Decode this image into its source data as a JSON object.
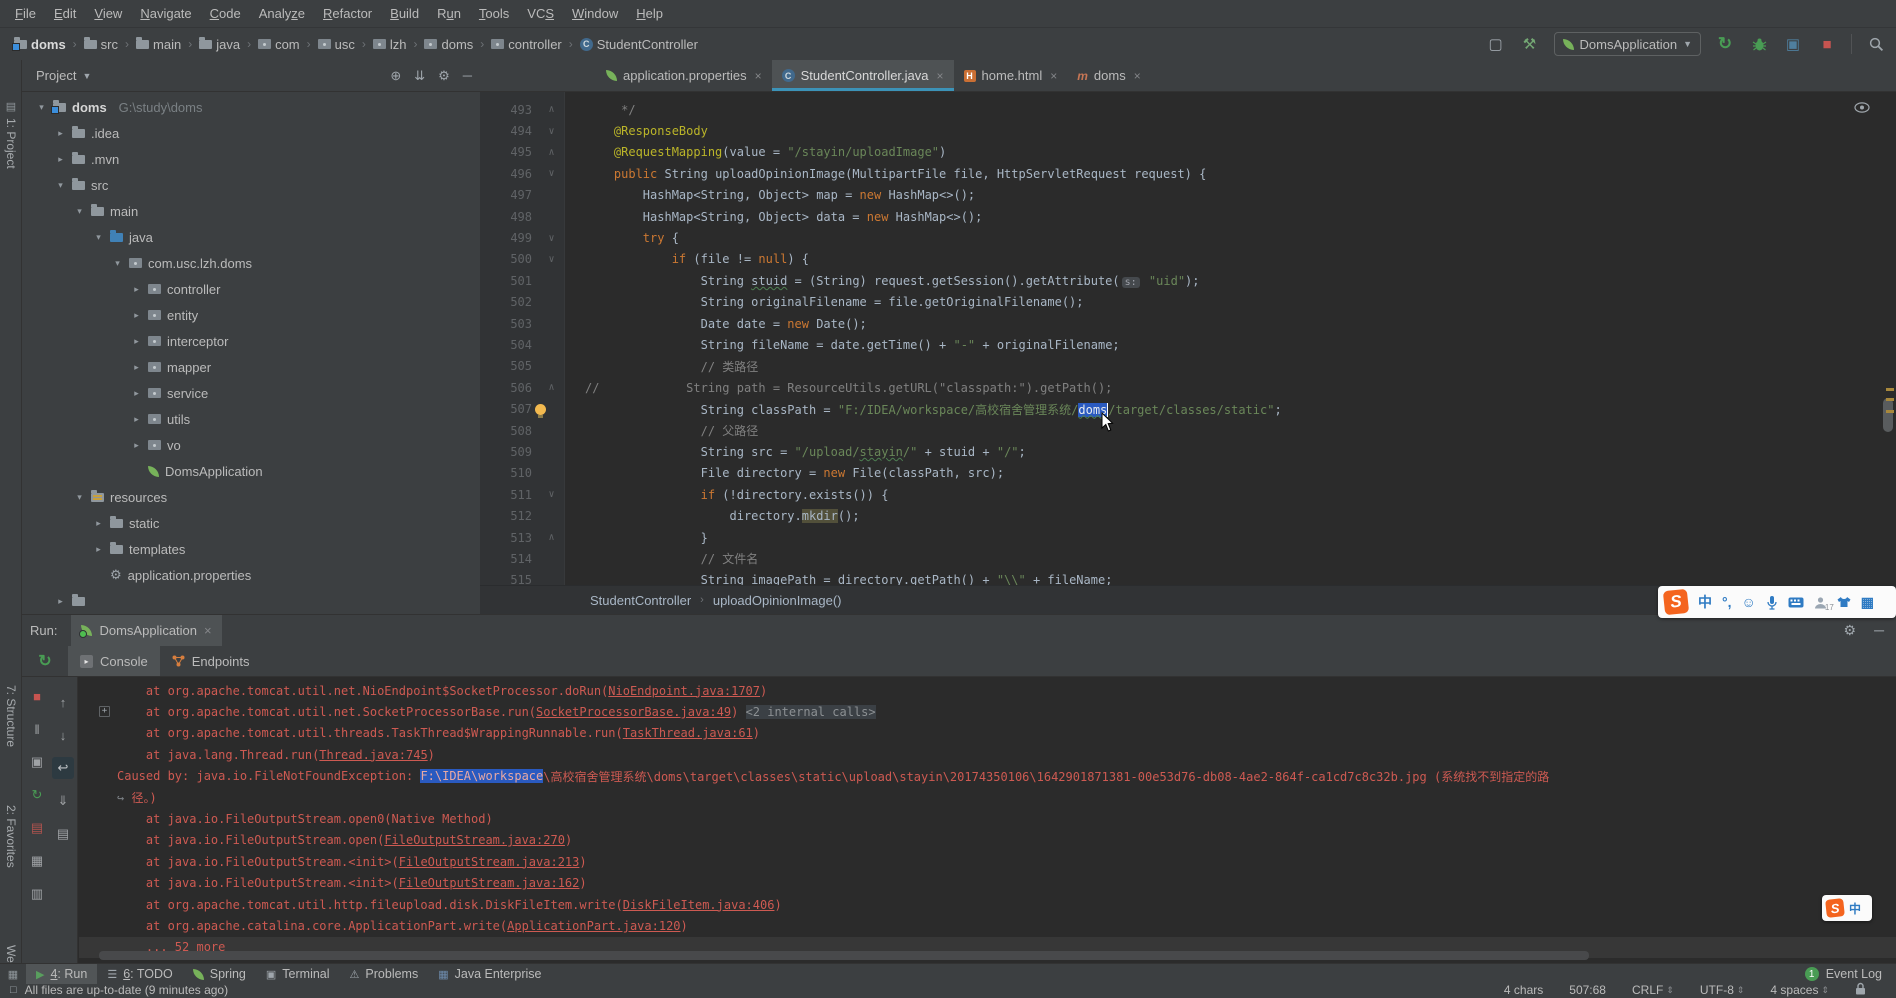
{
  "colors": {
    "chrome": "#3C3F41",
    "editor_bg": "#2B2B2B",
    "accent_blue": "#3C93B8",
    "selection": "#2A5AC0",
    "error_red": "#CE5A52",
    "string_green": "#6A8759",
    "keyword_orange": "#CC7832",
    "comment_gray": "#808080",
    "annotation_yellow": "#BBB529",
    "run_green": "#499C54",
    "stop_red": "#C75450"
  },
  "menu": {
    "items": [
      {
        "label": "File",
        "u": 0
      },
      {
        "label": "Edit",
        "u": 0
      },
      {
        "label": "View",
        "u": 0
      },
      {
        "label": "Navigate",
        "u": 0
      },
      {
        "label": "Code",
        "u": 0
      },
      {
        "label": "Analyze",
        "u": 5
      },
      {
        "label": "Refactor",
        "u": 0
      },
      {
        "label": "Build",
        "u": 0
      },
      {
        "label": "Run",
        "u": 1
      },
      {
        "label": "Tools",
        "u": 0
      },
      {
        "label": "VCS",
        "u": 2
      },
      {
        "label": "Window",
        "u": 0
      },
      {
        "label": "Help",
        "u": 0
      }
    ]
  },
  "toolbar": {
    "breadcrumbs": [
      {
        "label": "doms",
        "icon": "project",
        "bold": true
      },
      {
        "label": "src",
        "icon": "folder"
      },
      {
        "label": "main",
        "icon": "folder"
      },
      {
        "label": "java",
        "icon": "folder"
      },
      {
        "label": "com",
        "icon": "package"
      },
      {
        "label": "usc",
        "icon": "package"
      },
      {
        "label": "lzh",
        "icon": "package"
      },
      {
        "label": "doms",
        "icon": "package"
      },
      {
        "label": "controller",
        "icon": "package"
      },
      {
        "label": "StudentController",
        "icon": "class"
      }
    ],
    "run_config": "DomsApplication"
  },
  "stripe_labels": [
    "1: Project",
    "7: Structure",
    "2: Favorites",
    "Web"
  ],
  "project_panel": {
    "title": "Project",
    "tree": [
      {
        "d": 0,
        "ch": "open",
        "icon": "project",
        "label": "doms",
        "extra": "G:\\study\\doms",
        "bold": true
      },
      {
        "d": 1,
        "ch": "closed",
        "icon": "folder",
        "label": ".idea"
      },
      {
        "d": 1,
        "ch": "closed",
        "icon": "folder",
        "label": ".mvn"
      },
      {
        "d": 1,
        "ch": "open",
        "icon": "folder",
        "label": "src"
      },
      {
        "d": 2,
        "ch": "open",
        "icon": "folder",
        "label": "main"
      },
      {
        "d": 3,
        "ch": "open",
        "icon": "folder-java",
        "label": "java"
      },
      {
        "d": 4,
        "ch": "open",
        "icon": "package",
        "label": "com.usc.lzh.doms"
      },
      {
        "d": 5,
        "ch": "closed",
        "icon": "package",
        "label": "controller"
      },
      {
        "d": 5,
        "ch": "closed",
        "icon": "package",
        "label": "entity"
      },
      {
        "d": 5,
        "ch": "closed",
        "icon": "package",
        "label": "interceptor"
      },
      {
        "d": 5,
        "ch": "closed",
        "icon": "package",
        "label": "mapper"
      },
      {
        "d": 5,
        "ch": "closed",
        "icon": "package",
        "label": "service"
      },
      {
        "d": 5,
        "ch": "closed",
        "icon": "package",
        "label": "utils"
      },
      {
        "d": 5,
        "ch": "closed",
        "icon": "package",
        "label": "vo"
      },
      {
        "d": 5,
        "ch": "none",
        "icon": "spring",
        "label": "DomsApplication"
      },
      {
        "d": 2,
        "ch": "open",
        "icon": "folder-res",
        "label": "resources"
      },
      {
        "d": 3,
        "ch": "closed",
        "icon": "folder",
        "label": "static"
      },
      {
        "d": 3,
        "ch": "closed",
        "icon": "folder",
        "label": "templates"
      },
      {
        "d": 3,
        "ch": "none",
        "icon": "props",
        "label": "application.properties"
      },
      {
        "d": 1,
        "ch": "closed",
        "icon": "folder",
        "label": ""
      }
    ]
  },
  "editor": {
    "tabs": [
      {
        "label": "application.properties",
        "icon": "spring",
        "selected": false
      },
      {
        "label": "StudentController.java",
        "icon": "class",
        "selected": true
      },
      {
        "label": "home.html",
        "icon": "html",
        "selected": false
      },
      {
        "label": "doms",
        "icon": "maven",
        "selected": false
      }
    ],
    "breadcrumb_class": "StudentController",
    "breadcrumb_method": "uploadOpinionImage()",
    "lines": [
      {
        "n": 493,
        "f": "e",
        "seg": [
          [
            "     */",
            "c"
          ]
        ]
      },
      {
        "n": 494,
        "f": "s",
        "seg": [
          [
            "    ",
            "p"
          ],
          [
            "@ResponseBody",
            "a"
          ]
        ]
      },
      {
        "n": 495,
        "f": "e",
        "seg": [
          [
            "    ",
            "p"
          ],
          [
            "@RequestMapping",
            "a"
          ],
          [
            "(value = ",
            "p"
          ],
          [
            "\"/stayin/uploadImage\"",
            "s"
          ],
          [
            ")",
            "p"
          ]
        ]
      },
      {
        "n": 496,
        "f": "s",
        "seg": [
          [
            "    ",
            "p"
          ],
          [
            "public",
            "k"
          ],
          [
            " String uploadOpinionImage(MultipartFile file, HttpServletRequest request) {",
            "p"
          ]
        ]
      },
      {
        "n": 497,
        "f": "",
        "seg": [
          [
            "        HashMap<String, Object> map = ",
            "p"
          ],
          [
            "new",
            "k"
          ],
          [
            " HashMap<>();",
            "p"
          ]
        ]
      },
      {
        "n": 498,
        "f": "",
        "seg": [
          [
            "        HashMap<String, Object> data = ",
            "p"
          ],
          [
            "new",
            "k"
          ],
          [
            " HashMap<>();",
            "p"
          ]
        ]
      },
      {
        "n": 499,
        "f": "s",
        "seg": [
          [
            "        ",
            "p"
          ],
          [
            "try",
            "k"
          ],
          [
            " {",
            "p"
          ]
        ]
      },
      {
        "n": 500,
        "f": "s",
        "seg": [
          [
            "            ",
            "p"
          ],
          [
            "if",
            "k"
          ],
          [
            " (file != ",
            "p"
          ],
          [
            "null",
            "k"
          ],
          [
            ") {",
            "p"
          ]
        ]
      },
      {
        "n": 501,
        "f": "",
        "seg": [
          [
            "                String ",
            "p"
          ],
          [
            "stuid",
            "p w"
          ],
          [
            " = (String) request.getSession().getAttribute(",
            "p"
          ],
          [
            "s:",
            "hint"
          ],
          [
            " ",
            "p"
          ],
          [
            "\"uid\"",
            "s"
          ],
          [
            ");",
            "p"
          ]
        ]
      },
      {
        "n": 502,
        "f": "",
        "seg": [
          [
            "                String originalFilename = file.getOriginalFilename();",
            "p"
          ]
        ]
      },
      {
        "n": 503,
        "f": "",
        "seg": [
          [
            "                Date date = ",
            "p"
          ],
          [
            "new",
            "k"
          ],
          [
            " Date();",
            "p"
          ]
        ]
      },
      {
        "n": 504,
        "f": "",
        "seg": [
          [
            "                String fileName = date.getTime() + ",
            "p"
          ],
          [
            "\"-\"",
            "s"
          ],
          [
            " + originalFilename;",
            "p"
          ]
        ]
      },
      {
        "n": 505,
        "f": "",
        "seg": [
          [
            "                ",
            "p"
          ],
          [
            "// 类路径",
            "c"
          ]
        ]
      },
      {
        "n": 506,
        "f": "e",
        "seg": [
          [
            "//            String path = ResourceUtils.getURL(\"classpath:\").getPath();",
            "c"
          ]
        ]
      },
      {
        "n": 507,
        "f": "",
        "bulb": true,
        "seg": [
          [
            "                String classPath = ",
            "p"
          ],
          [
            "\"F:/IDEA/workspace/高校宿舍管理系统/",
            "s"
          ],
          [
            "doms",
            "s sel w cur"
          ],
          [
            "/target/classes/static\"",
            "s"
          ],
          [
            ";",
            "p"
          ]
        ]
      },
      {
        "n": 508,
        "f": "",
        "seg": [
          [
            "                ",
            "p"
          ],
          [
            "// 父路径",
            "c"
          ]
        ]
      },
      {
        "n": 509,
        "f": "",
        "seg": [
          [
            "                String src = ",
            "p"
          ],
          [
            "\"/upload/",
            "s"
          ],
          [
            "stayin",
            "s w"
          ],
          [
            "/\"",
            "s"
          ],
          [
            " + stuid + ",
            "p"
          ],
          [
            "\"/\"",
            "s"
          ],
          [
            ";",
            "p"
          ]
        ]
      },
      {
        "n": 510,
        "f": "",
        "seg": [
          [
            "                File directory = ",
            "p"
          ],
          [
            "new",
            "k"
          ],
          [
            " File(classPath, src);",
            "p"
          ]
        ]
      },
      {
        "n": 511,
        "f": "s",
        "seg": [
          [
            "                ",
            "p"
          ],
          [
            "if",
            "k"
          ],
          [
            " (!directory.exists()) {",
            "p"
          ]
        ]
      },
      {
        "n": 512,
        "f": "",
        "seg": [
          [
            "                    directory.",
            "p"
          ],
          [
            "mkdir",
            "p hl"
          ],
          [
            "();",
            "p"
          ]
        ]
      },
      {
        "n": 513,
        "f": "e",
        "seg": [
          [
            "                }",
            "p"
          ]
        ]
      },
      {
        "n": 514,
        "f": "",
        "seg": [
          [
            "                ",
            "p"
          ],
          [
            "// 文件名",
            "c"
          ]
        ]
      },
      {
        "n": 515,
        "f": "",
        "seg": [
          [
            "                String imagePath = directory.getPath() + ",
            "p"
          ],
          [
            "\"\\\\\"",
            "s"
          ],
          [
            " + fileName;",
            "p"
          ]
        ]
      }
    ]
  },
  "run_panel": {
    "label": "Run:",
    "tab": "DomsApplication",
    "tabs": [
      "Console",
      "Endpoints"
    ],
    "toolbar1": [
      {
        "name": "stop-icon",
        "glyph": "■",
        "color": "#C75450"
      },
      {
        "name": "pause-output-icon",
        "glyph": "‖",
        "color": "#9FA2A5"
      },
      {
        "name": "thread-dump-icon",
        "glyph": "▣",
        "color": "#9FA2A5"
      },
      {
        "name": "update-app-icon",
        "glyph": "↻",
        "color": "#499C54"
      },
      {
        "name": "docs-icon",
        "glyph": "▤",
        "color": "#B3544F"
      },
      {
        "name": "layout-icon",
        "glyph": "▦",
        "color": "#9FA2A5"
      },
      {
        "name": "trash-icon",
        "glyph": "▥",
        "color": "#9FA2A5"
      }
    ],
    "toolbar2": [
      {
        "name": "up-stack-icon",
        "glyph": "↑",
        "color": "#9FA2A5"
      },
      {
        "name": "down-stack-icon",
        "glyph": "↓",
        "color": "#9FA2A5"
      },
      {
        "name": "soft-wrap-icon",
        "glyph": "↩",
        "color": "#BFC3C6",
        "on": true
      },
      {
        "name": "scroll-end-icon",
        "glyph": "⇓",
        "color": "#9FA2A5"
      },
      {
        "name": "print-icon",
        "glyph": "▤",
        "color": "#9FA2A5"
      }
    ],
    "console_lines": [
      {
        "seg": [
          [
            "    at org.apache.tomcat.util.net.NioEndpoint$SocketProcessor.doRun(",
            "e"
          ],
          [
            "NioEndpoint.java:1707",
            "lnk"
          ],
          [
            ")",
            "e"
          ]
        ]
      },
      {
        "fold": true,
        "seg": [
          [
            "    at org.apache.tomcat.util.net.SocketProcessorBase.run(",
            "e"
          ],
          [
            "SocketProcessorBase.java:49",
            "lnk"
          ],
          [
            ") ",
            "e"
          ],
          [
            "<2 internal calls>",
            "chip"
          ]
        ]
      },
      {
        "seg": [
          [
            "    at org.apache.tomcat.util.threads.TaskThread$WrappingRunnable.run(",
            "e"
          ],
          [
            "TaskThread.java:61",
            "lnk"
          ],
          [
            ")",
            "e"
          ]
        ]
      },
      {
        "seg": [
          [
            "    at java.lang.Thread.run(",
            "e"
          ],
          [
            "Thread.java:745",
            "lnk"
          ],
          [
            ")",
            "e"
          ]
        ]
      },
      {
        "seg": [
          [
            "Caused by: java.io.FileNotFoundException: ",
            "e"
          ],
          [
            "F:\\IDEA\\workspace",
            "e csel"
          ],
          [
            "\\高校宿舍管理系统\\doms\\target\\classes\\static\\upload\\stayin\\20174350106\\1642901871381-00e53d76-db08-4ae2-864f-ca1cd7c8c32b.jpg (系统找不到指定的路",
            "e"
          ]
        ]
      },
      {
        "seg": [
          [
            "↪ ",
            "wr"
          ],
          [
            "径。)",
            "e"
          ]
        ]
      },
      {
        "seg": [
          [
            "    at java.io.FileOutputStream.open0(Native Method)",
            "e"
          ]
        ]
      },
      {
        "seg": [
          [
            "    at java.io.FileOutputStream.open(",
            "e"
          ],
          [
            "FileOutputStream.java:270",
            "lnk"
          ],
          [
            ")",
            "e"
          ]
        ]
      },
      {
        "seg": [
          [
            "    at java.io.FileOutputStream.<init>(",
            "e"
          ],
          [
            "FileOutputStream.java:213",
            "lnk"
          ],
          [
            ")",
            "e"
          ]
        ]
      },
      {
        "seg": [
          [
            "    at java.io.FileOutputStream.<init>(",
            "e"
          ],
          [
            "FileOutputStream.java:162",
            "lnk"
          ],
          [
            ")",
            "e"
          ]
        ]
      },
      {
        "seg": [
          [
            "    at org.apache.tomcat.util.http.fileupload.disk.DiskFileItem.write(",
            "e"
          ],
          [
            "DiskFileItem.java:406",
            "lnk"
          ],
          [
            ")",
            "e"
          ]
        ]
      },
      {
        "seg": [
          [
            "    at org.apache.catalina.core.ApplicationPart.write(",
            "e"
          ],
          [
            "ApplicationPart.java:120",
            "lnk"
          ],
          [
            ")",
            "e"
          ]
        ]
      },
      {
        "hi": true,
        "seg": [
          [
            "    ... 52 more",
            "e"
          ]
        ]
      }
    ]
  },
  "bottom_bar": {
    "items": [
      {
        "label": "4: Run",
        "u": 0,
        "glyph": "▶",
        "color": "#599E5E",
        "selected": true
      },
      {
        "label": "6: TODO",
        "u": 0,
        "glyph": "☰",
        "color": "#9FA6AC"
      },
      {
        "label": "Spring",
        "glyph": "leaf",
        "color": "#77B25A"
      },
      {
        "label": "Terminal",
        "glyph": "▣",
        "color": "#9FA6AC"
      },
      {
        "label": "Problems",
        "glyph": "⚠",
        "color": "#9FA6AC"
      },
      {
        "label": "Java Enterprise",
        "glyph": "▦",
        "color": "#6E8CAE"
      }
    ],
    "event_log": "Event Log",
    "event_badge": "1"
  },
  "status_bar": {
    "left_icon": "□",
    "left": "All files are up-to-date (9 minutes ago)",
    "items": [
      {
        "label": "4 chars",
        "chev": false
      },
      {
        "label": "507:68",
        "chev": false
      },
      {
        "label": "CRLF",
        "chev": true
      },
      {
        "label": "UTF-8",
        "chev": true
      },
      {
        "label": "4 spaces",
        "chev": true
      }
    ]
  },
  "ime": {
    "logo": "S",
    "items": [
      "中",
      "°,",
      "☺",
      "mic",
      "keyboard",
      "person",
      "shirt",
      "▦"
    ],
    "person_badge": "17",
    "mini_items": [
      "中"
    ]
  }
}
